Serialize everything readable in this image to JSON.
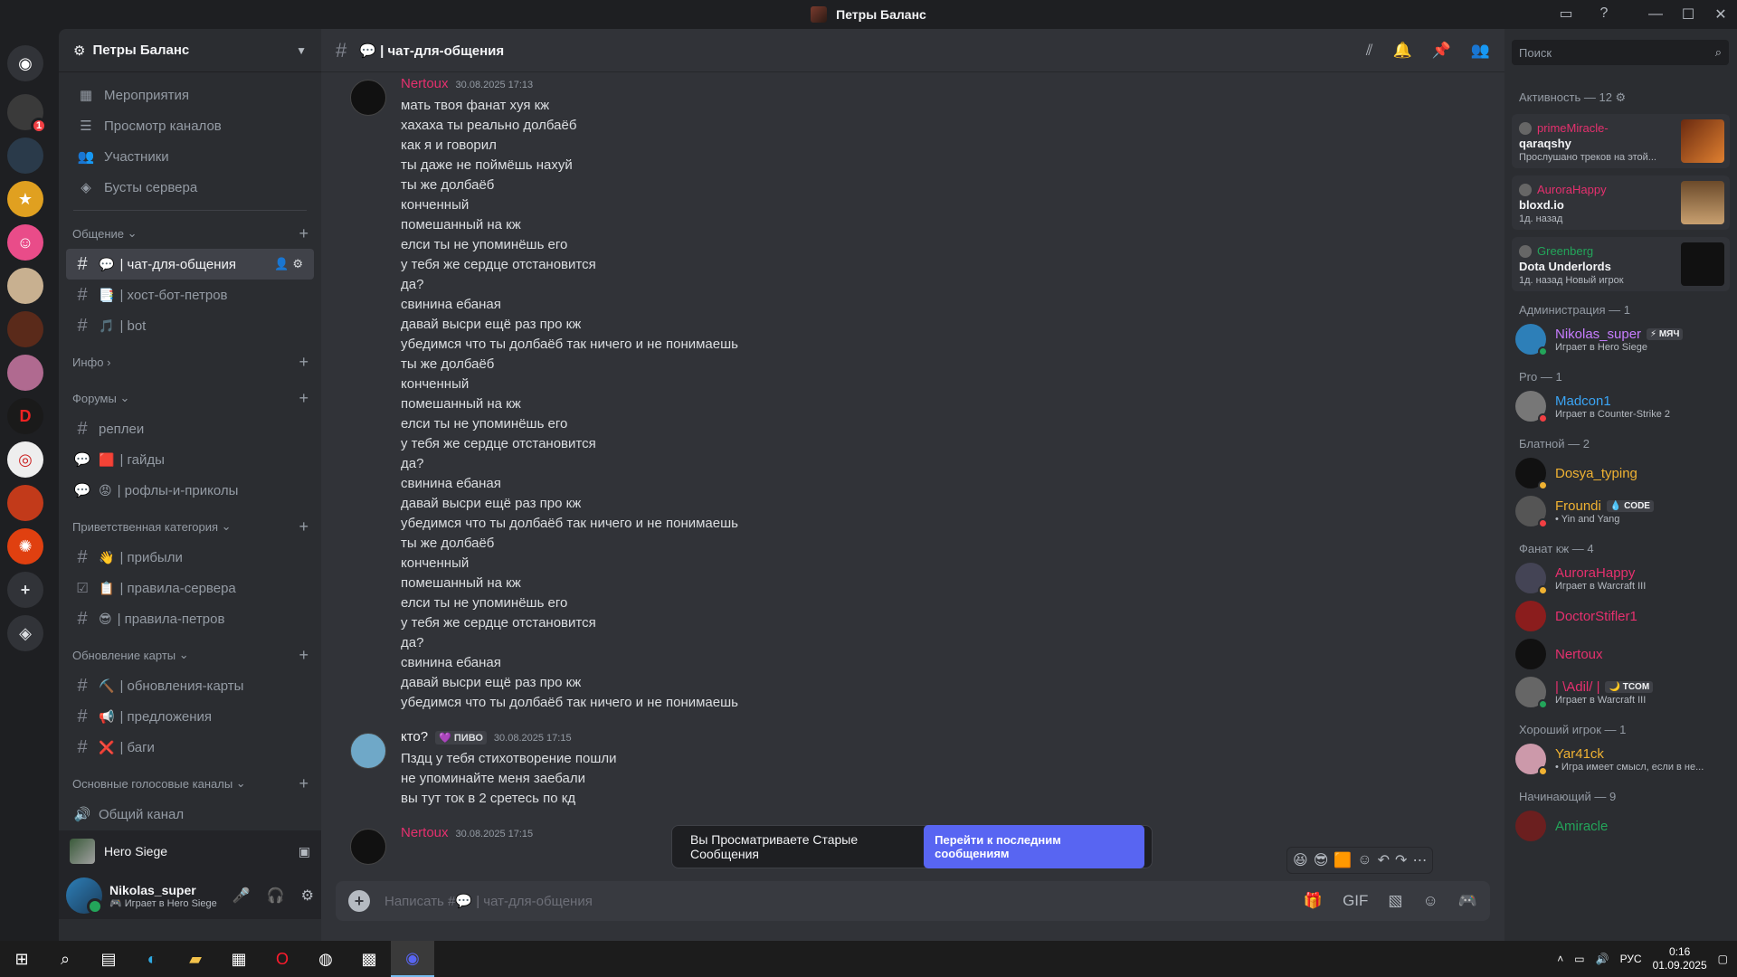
{
  "window": {
    "title": "Петры Баланс"
  },
  "rail": {
    "badge": "1"
  },
  "server": {
    "name": "Петры Баланс",
    "menu": [
      {
        "icon": "calendar-icon",
        "label": "Мероприятия"
      },
      {
        "icon": "browse-channels-icon",
        "label": "Просмотр каналов"
      },
      {
        "icon": "members-icon",
        "label": "Участники"
      },
      {
        "icon": "boost-icon",
        "label": "Бусты сервера"
      }
    ],
    "categories": [
      {
        "name": "Общение",
        "channels": [
          {
            "emoji": "💬",
            "name": "| чат-для-общения",
            "active": true
          },
          {
            "emoji": "📑",
            "name": "| хост-бот-петров"
          },
          {
            "emoji": "🎵",
            "name": "| bot"
          }
        ]
      },
      {
        "name": "Инфо",
        "channels": []
      },
      {
        "name": "Форумы",
        "channels": [
          {
            "emoji": "",
            "name": "реплеи"
          },
          {
            "emoji": "🟥",
            "name": "| гайды"
          },
          {
            "emoji": "😡",
            "name": "| рофлы-и-приколы"
          }
        ]
      },
      {
        "name": "Приветственная категория",
        "channels": [
          {
            "emoji": "👋",
            "name": "| прибыли"
          },
          {
            "emoji": "📋",
            "name": "| правила-сервера"
          },
          {
            "emoji": "😎",
            "name": "| правила-петров"
          }
        ]
      },
      {
        "name": "Обновление карты",
        "channels": [
          {
            "emoji": "⛏️",
            "name": "| обновления-карты"
          },
          {
            "emoji": "📢",
            "name": "| предложения"
          },
          {
            "emoji": "❌",
            "name": "| баги"
          }
        ]
      },
      {
        "name": "Основные голосовые каналы",
        "channels": [
          {
            "emoji": "",
            "name": "Общий канал"
          }
        ]
      }
    ]
  },
  "voice": {
    "activity": "Hero Siege"
  },
  "user": {
    "name": "Nikolas_super",
    "status": "Играет в Hero Siege"
  },
  "chat": {
    "channel": "💬 | чат-для-общения",
    "messages": [
      {
        "author": "Nertoux",
        "color": "#e5306e",
        "time": "30.08.2025 17:13",
        "tag": "",
        "lines": [
          "мать твоя фанат хуя кж",
          "хахаха ты реально долбаёб",
          "как я и говорил",
          "ты даже не поймёшь нахуй",
          "ты же долбаёб",
          "конченный",
          "помешанный на кж",
          "елси ты не упоминёшь его",
          "у тебя же сердце отстановится",
          "да?",
          "свинина ебаная",
          "давай высри ещё раз про кж",
          "убедимся что ты долбаёб так ничего и не понимаешь",
          "ты же долбаёб",
          "конченный",
          "помешанный на кж",
          "елси ты не упоминёшь его",
          "у тебя же сердце отстановится",
          "да?",
          "свинина ебаная",
          "давай высри ещё раз про кж",
          "убедимся что ты долбаёб так ничего и не понимаешь",
          "ты же долбаёб",
          "конченный",
          "помешанный на кж",
          "елси ты не упоминёшь его",
          "у тебя же сердце отстановится",
          "да?",
          "свинина ебаная",
          "давай высри ещё раз про кж",
          "убедимся что ты долбаёб так ничего и не понимаешь"
        ]
      },
      {
        "author": "кто?",
        "color": "#f2f3f5",
        "time": "30.08.2025 17:15",
        "tag": "💜 ПИВО",
        "lines": [
          "Пздц у тебя стихотворение пошли",
          "не упоминайте меня заебали",
          "вы тут ток в 2 сретесь по кд"
        ]
      },
      {
        "author": "Nertoux",
        "color": "#e5306e",
        "time": "30.08.2025 17:15",
        "tag": "",
        "lines": []
      }
    ],
    "old_banner": "Вы Просматриваете Старые Сообщения",
    "jump_label": "Перейти к последним сообщениям",
    "composer_placeholder": "Написать #💬 | чат-для-общения"
  },
  "members": {
    "search_placeholder": "Поиск",
    "activity_header": "Активность — 12",
    "activities": [
      {
        "user": "primeMiracle-",
        "color": "#e5306e",
        "game": "qaraqshy",
        "detail": "Прослушано треков на этой..."
      },
      {
        "user": "AuroraHappy",
        "color": "#e5306e",
        "game": "bloxd.io",
        "detail": "1д. назад"
      },
      {
        "user": "Greenberg",
        "color": "#23a55a",
        "game": "Dota Underlords",
        "detail": "1д. назад  Новый игрок"
      }
    ],
    "groups": [
      {
        "title": "Администрация — 1",
        "members": [
          {
            "name": "Nikolas_super",
            "color": "#c77dff",
            "badge": "⚡ МЯЧ",
            "sub": "Играет в Hero Siege",
            "status": "#23a55a",
            "av": "#2d7fb8"
          }
        ]
      },
      {
        "title": "Pro — 1",
        "members": [
          {
            "name": "Madcon1",
            "color": "#3ba5f5",
            "badge": "",
            "sub": "Играет в Counter-Strike 2",
            "status": "#f23f43",
            "av": "#777"
          }
        ]
      },
      {
        "title": "Блатной — 2",
        "members": [
          {
            "name": "Dosya_typing",
            "color": "#f0b232",
            "badge": "",
            "sub": "",
            "status": "#f0b232",
            "av": "#111"
          },
          {
            "name": "Froundi",
            "color": "#f0b232",
            "badge": "💧 CODE",
            "sub": "• Yin and Yang",
            "status": "#f23f43",
            "av": "#555"
          }
        ]
      },
      {
        "title": "Фанат кж — 4",
        "members": [
          {
            "name": "AuroraHappy",
            "color": "#e5306e",
            "badge": "",
            "sub": "Играет в Warcraft III",
            "status": "#f0b232",
            "av": "#445"
          },
          {
            "name": "DoctorStifler1",
            "color": "#e5306e",
            "badge": "",
            "sub": "",
            "status": "",
            "av": "#8b1d1d"
          },
          {
            "name": "Nertoux",
            "color": "#e5306e",
            "badge": "",
            "sub": "",
            "status": "",
            "av": "#111"
          },
          {
            "name": "| \\Adil/ |",
            "color": "#e5306e",
            "badge": "🌙 TCOM",
            "sub": "Играет в Warcraft III",
            "status": "#23a55a",
            "av": "#666"
          }
        ]
      },
      {
        "title": "Хороший игрок — 1",
        "members": [
          {
            "name": "Yar41ck",
            "color": "#f0b232",
            "badge": "",
            "sub": "• Игра имеет смысл, если в не...",
            "status": "#f0b232",
            "av": "#c9a"
          }
        ]
      },
      {
        "title": "Начинающий — 9",
        "members": [
          {
            "name": "Amiracle",
            "color": "#23a55a",
            "badge": "",
            "sub": "",
            "status": "",
            "av": "#6b1f1f"
          }
        ]
      }
    ]
  },
  "taskbar": {
    "lang": "РУС",
    "time": "0:16",
    "date": "01.09.2025"
  }
}
